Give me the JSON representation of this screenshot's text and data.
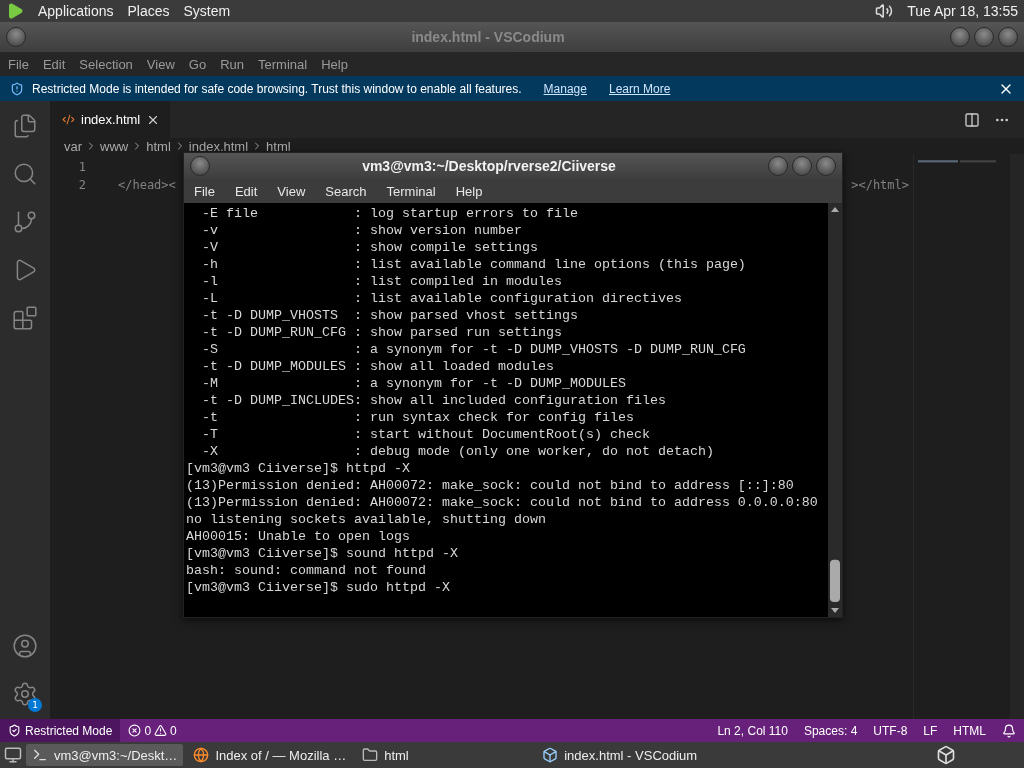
{
  "top_panel": {
    "menus": [
      "Applications",
      "Places",
      "System"
    ],
    "clock": "Tue Apr 18, 13:55"
  },
  "editor_window": {
    "title": "index.html - VSCodium",
    "menu": [
      "File",
      "Edit",
      "Selection",
      "View",
      "Go",
      "Run",
      "Terminal",
      "Help"
    ],
    "banner": {
      "message": "Restricted Mode is intended for safe code browsing. Trust this window to enable all features.",
      "links": [
        "Manage",
        "Learn More"
      ]
    },
    "tabs": [
      {
        "label": "index.html",
        "selected": true
      }
    ],
    "breadcrumbs": [
      "var",
      "www",
      "html",
      "index.html",
      "html"
    ],
    "lines": [
      {
        "number": "1"
      },
      {
        "number": "2",
        "left": "</head><",
        "right": "></html>"
      }
    ],
    "settings_badge": "1",
    "status_bar": {
      "mode": "Restricted Mode",
      "errors": "0",
      "warnings": "0",
      "items": [
        "Ln 2, Col 110",
        "Spaces: 4",
        "UTF-8",
        "LF",
        "HTML"
      ]
    }
  },
  "terminal_window": {
    "title": "vm3@vm3:~/Desktop/rverse2/Ciiverse",
    "menu": [
      "File",
      "Edit",
      "View",
      "Search",
      "Terminal",
      "Help"
    ],
    "lines": [
      "  -E file            : log startup errors to file",
      "  -v                 : show version number",
      "  -V                 : show compile settings",
      "  -h                 : list available command line options (this page)",
      "  -l                 : list compiled in modules",
      "  -L                 : list available configuration directives",
      "  -t -D DUMP_VHOSTS  : show parsed vhost settings",
      "  -t -D DUMP_RUN_CFG : show parsed run settings",
      "  -S                 : a synonym for -t -D DUMP_VHOSTS -D DUMP_RUN_CFG",
      "  -t -D DUMP_MODULES : show all loaded modules",
      "  -M                 : a synonym for -t -D DUMP_MODULES",
      "  -t -D DUMP_INCLUDES: show all included configuration files",
      "  -t                 : run syntax check for config files",
      "  -T                 : start without DocumentRoot(s) check",
      "  -X                 : debug mode (only one worker, do not detach)",
      "[vm3@vm3 Ciiverse]$ httpd -X",
      "(13)Permission denied: AH00072: make_sock: could not bind to address [::]:80",
      "(13)Permission denied: AH00072: make_sock: could not bind to address 0.0.0.0:80",
      "no listening sockets available, shutting down",
      "AH00015: Unable to open logs",
      "[vm3@vm3 Ciiverse]$ sound httpd -X",
      "bash: sound: command not found",
      "[vm3@vm3 Ciiverse]$ sudo httpd -X"
    ]
  },
  "taskbar": {
    "items": [
      {
        "kind": "terminal",
        "label": "vm3@vm3:~/Deskt…",
        "selected": true
      },
      {
        "kind": "browser",
        "label": "Index of / — Mozilla …",
        "selected": false
      },
      {
        "kind": "folder",
        "label": "html",
        "selected": false
      },
      {
        "kind": "editor",
        "label": "index.html - VSCodium",
        "selected": false
      }
    ]
  }
}
